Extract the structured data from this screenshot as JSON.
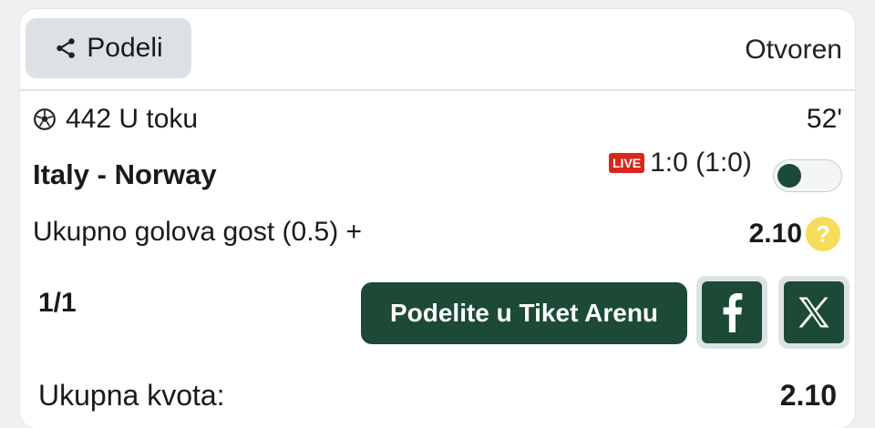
{
  "header": {
    "share_label": "Podeli",
    "status": "Otvoren"
  },
  "event": {
    "league": "442 U toku",
    "minute": "52'",
    "teams": "Italy - Norway",
    "live_badge": "LIVE",
    "score": "1:0 (1:0)",
    "toggle_on": false
  },
  "selection": {
    "market": "Ukupno golova gost (0.5) +",
    "odd": "2.10",
    "help_icon": "?"
  },
  "ticket": {
    "count": "1/1",
    "arena_button": "Podelite u Tiket Arenu"
  },
  "social": {
    "facebook_icon": "facebook-icon",
    "x_icon": "x-icon"
  },
  "total": {
    "label": "Ukupna kvota:",
    "value": "2.10"
  },
  "colors": {
    "accent": "#1c4a36",
    "live": "#d9271e",
    "help": "#f5dc5a",
    "button_bg": "#dde1e5"
  }
}
